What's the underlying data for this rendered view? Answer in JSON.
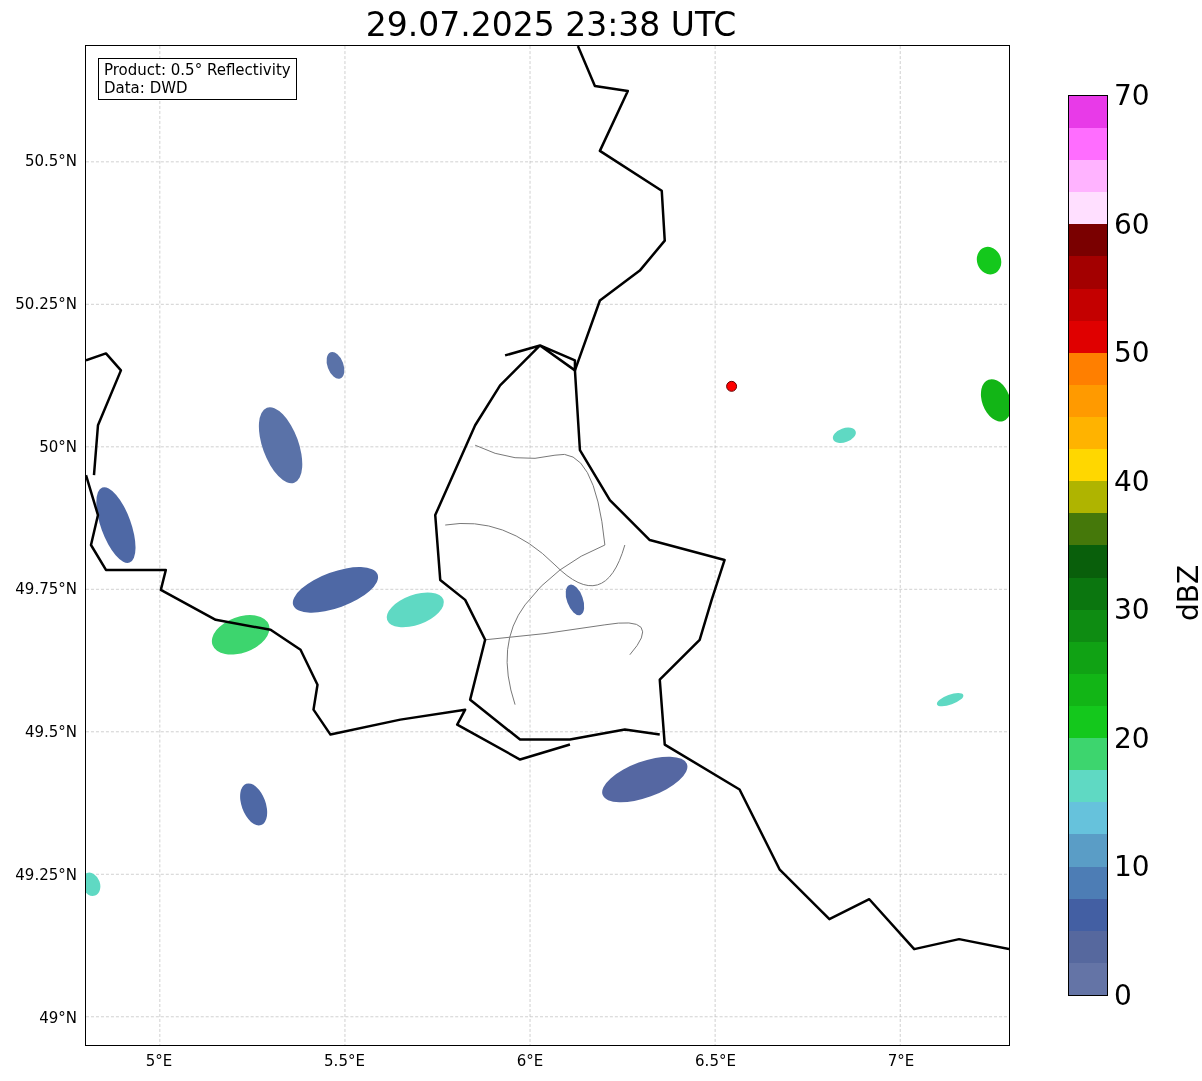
{
  "title": "29.07.2025 23:38 UTC",
  "legend": {
    "lines": [
      "Product: 0.5° Reflectivity",
      "Data: DWD"
    ]
  },
  "y_ticks": [
    "50.5°N",
    "50.25°N",
    "50°N",
    "49.75°N",
    "49.5°N",
    "49.25°N",
    "49°N"
  ],
  "x_ticks": [
    "5°E",
    "5.5°E",
    "6°E",
    "6.5°E",
    "7°E"
  ],
  "colorbar": {
    "label": "dBZ",
    "ticks": [
      "70",
      "60",
      "50",
      "40",
      "30",
      "20",
      "10",
      "0"
    ],
    "segments": [
      {
        "color": "#6474a6"
      },
      {
        "color": "#56689e"
      },
      {
        "color": "#435fa3"
      },
      {
        "color": "#4d7db5"
      },
      {
        "color": "#5a9dc6"
      },
      {
        "color": "#66c2dc"
      },
      {
        "color": "#5fd9c3"
      },
      {
        "color": "#3dd56e"
      },
      {
        "color": "#14c81c"
      },
      {
        "color": "#12b516"
      },
      {
        "color": "#10a214"
      },
      {
        "color": "#0e8c12"
      },
      {
        "color": "#0b760f"
      },
      {
        "color": "#095f0b"
      },
      {
        "color": "#45780a"
      },
      {
        "color": "#afb400"
      },
      {
        "color": "#ffd700"
      },
      {
        "color": "#ffb300"
      },
      {
        "color": "#ff9a00"
      },
      {
        "color": "#ff7f00"
      },
      {
        "color": "#e00000"
      },
      {
        "color": "#c40000"
      },
      {
        "color": "#a30000"
      },
      {
        "color": "#7a0000"
      },
      {
        "color": "#ffdfff"
      },
      {
        "color": "#ffb3ff"
      },
      {
        "color": "#ff6dff"
      },
      {
        "color": "#e83ae8"
      }
    ]
  }
}
